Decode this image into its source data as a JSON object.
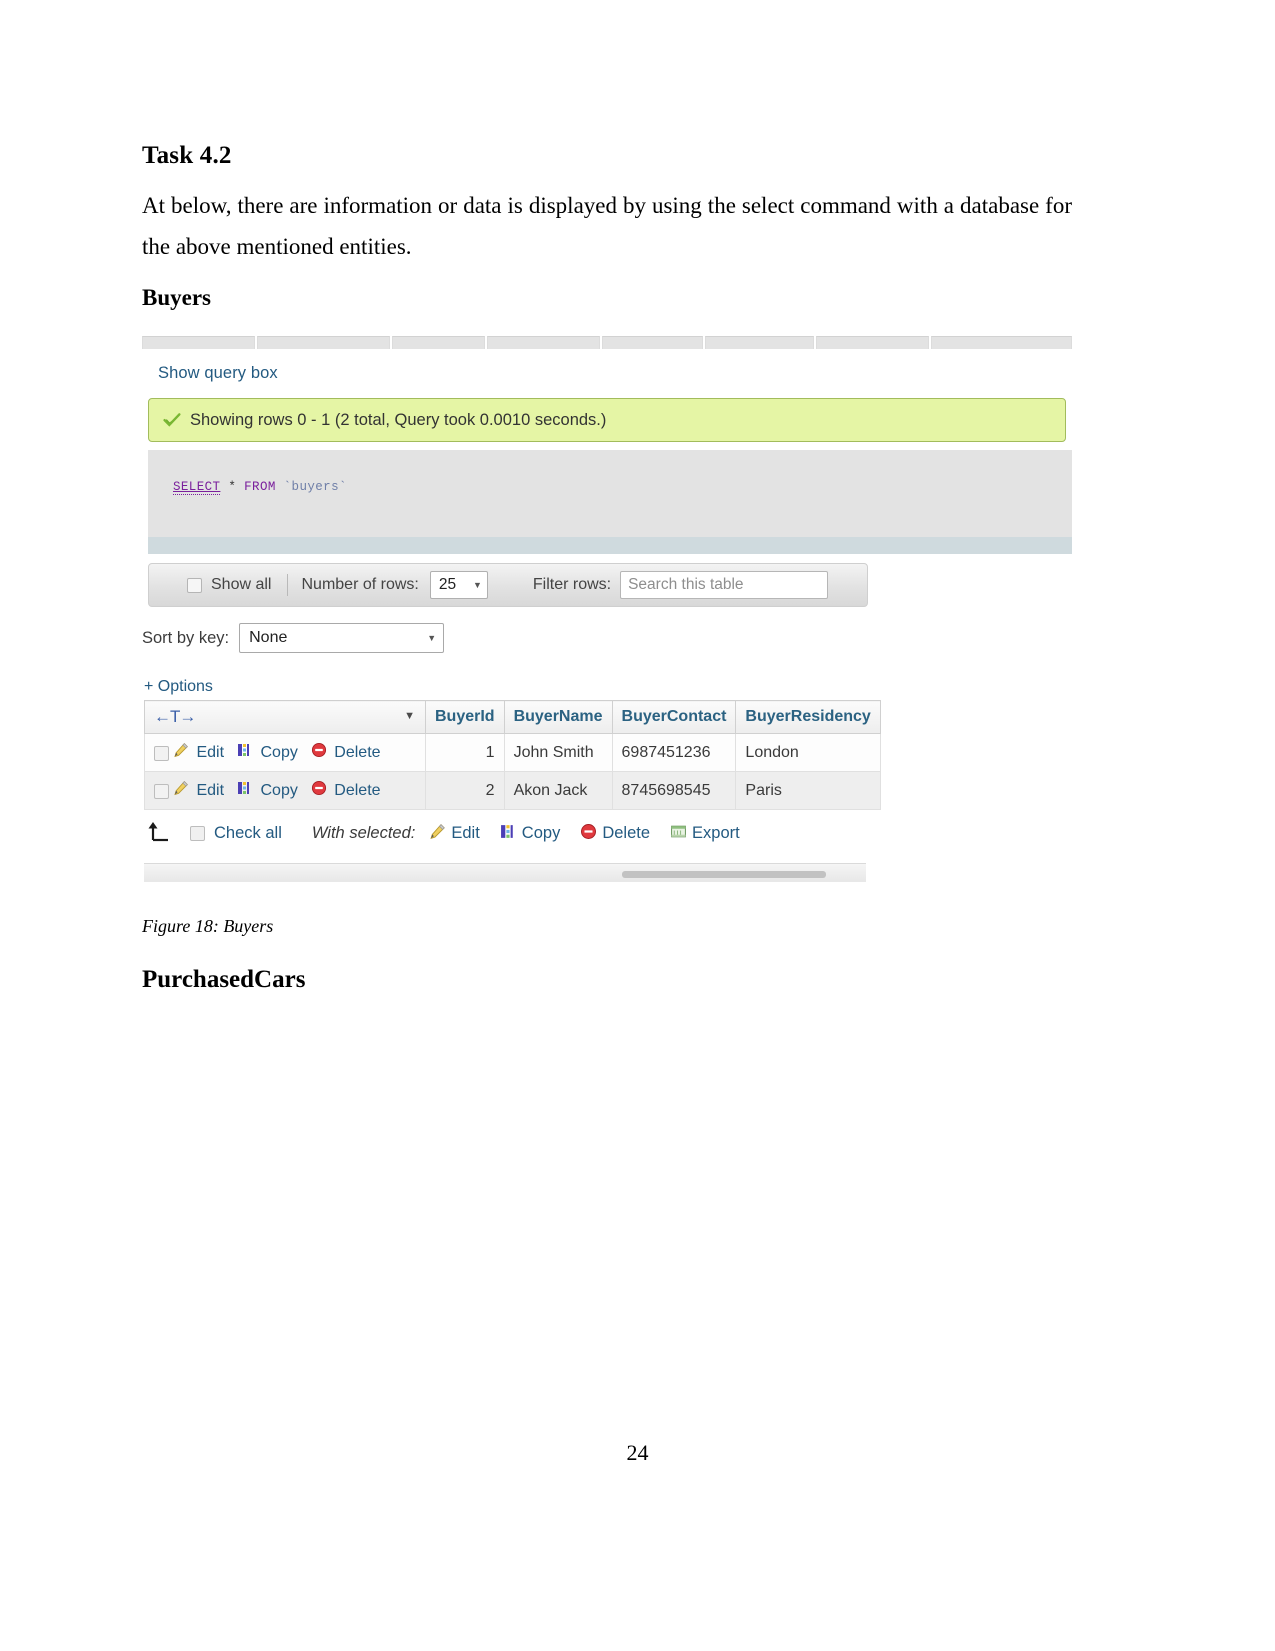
{
  "document": {
    "heading": "Task 4.2",
    "paragraph": "At below, there are information or data is displayed by using the select command with a database for the above mentioned entities.",
    "section_buyers": "Buyers",
    "figure_caption": "Figure 18: Buyers",
    "section_purchased_cars": "PurchasedCars",
    "page_number": "24"
  },
  "screenshot": {
    "show_query_link": "Show query box",
    "success": {
      "icon": "check-icon",
      "message": "Showing rows 0 - 1 (2 total, Query took 0.0010 seconds.)",
      "background": "#e5f5a5",
      "border": "#a2bc5c"
    },
    "sql": {
      "keyword_select": "SELECT",
      "star": "*",
      "keyword_from": "FROM",
      "table": "`buyers`"
    },
    "controls": {
      "show_all_label": "Show all",
      "number_of_rows_label": "Number of rows:",
      "number_of_rows_value": "25",
      "filter_rows_label": "Filter rows:",
      "filter_placeholder": "Search this table"
    },
    "sort": {
      "label": "Sort by key:",
      "value": "None"
    },
    "options_link": "+ Options",
    "table": {
      "actions_header": "←T→",
      "columns": [
        "BuyerId",
        "BuyerName",
        "BuyerContact",
        "BuyerResidency"
      ],
      "row_actions": [
        "Edit",
        "Copy",
        "Delete"
      ],
      "rows": [
        {
          "BuyerId": "1",
          "BuyerName": "John Smith",
          "BuyerContact": "6987451236",
          "BuyerResidency": "London"
        },
        {
          "BuyerId": "2",
          "BuyerName": "Akon Jack",
          "BuyerContact": "8745698545",
          "BuyerResidency": "Paris"
        }
      ]
    },
    "footer": {
      "check_all": "Check all",
      "with_selected": "With selected:",
      "actions": [
        "Edit",
        "Copy",
        "Delete",
        "Export"
      ]
    },
    "colors": {
      "link": "#235a81",
      "header_text": "#2b6282",
      "success_bg": "#e5f5a5",
      "sql_keyword": "#7a1f9c"
    }
  }
}
